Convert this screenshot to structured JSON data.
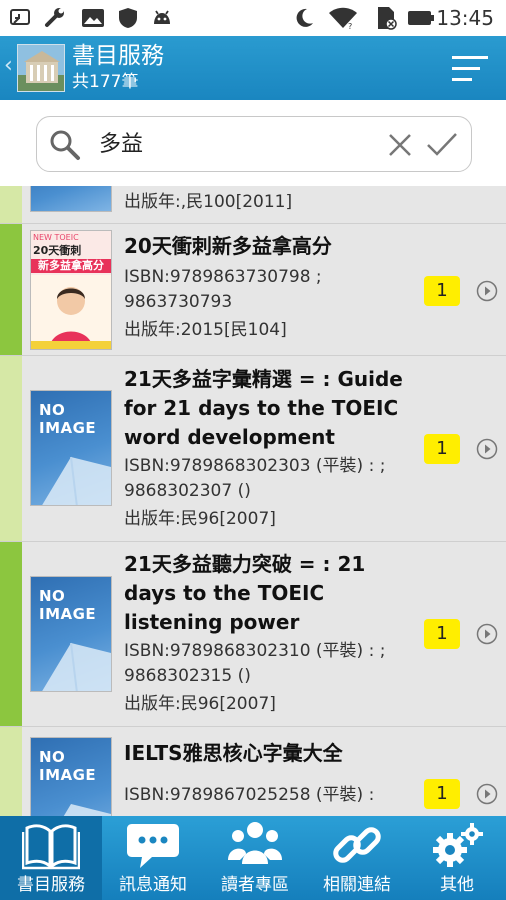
{
  "status_bar": {
    "time": "13:45",
    "icons": [
      "cast-icon",
      "wrench-icon",
      "image-icon",
      "shield-icon",
      "android-icon",
      "moon-icon",
      "wifi-icon",
      "sim-icon",
      "battery-icon"
    ]
  },
  "header": {
    "title": "書目服務",
    "subtitle": "共177筆"
  },
  "search": {
    "query": "多益"
  },
  "results": [
    {
      "cover": "partial",
      "lines": [
        "出版年:,民100[2011]"
      ]
    },
    {
      "title": "20天衝刺新多益拿高分",
      "isbn": "ISBN:9789863730798 ; 9863730793",
      "year": "出版年:2015[民104]",
      "count": "1",
      "cover_texts": [
        "NEW TOEIC",
        "20天衝刺",
        "新多益拿高分"
      ]
    },
    {
      "title": "21天多益字彙精選 = : Guide for 21 days to the TOEIC word development",
      "isbn": "ISBN:9789868302303 (平裝) : ; 9868302307 ()",
      "year": "出版年:民96[2007]",
      "count": "1",
      "noimage": "NO IMAGE"
    },
    {
      "title": "21天多益聽力突破 = : 21 days to the TOEIC listening power",
      "isbn": "ISBN:9789868302310 (平裝) : ; 9868302315 ()",
      "year": "出版年:民96[2007]",
      "count": "1",
      "noimage": "NO IMAGE"
    },
    {
      "title": "IELTS雅思核心字彙大全",
      "isbn": "ISBN:9789867025258 (平裝) :",
      "count": "1",
      "noimage": "NO IMAGE"
    }
  ],
  "tabs": [
    {
      "label": "書目服務",
      "icon": "book-icon",
      "active": true
    },
    {
      "label": "訊息通知",
      "icon": "chat-icon",
      "active": false
    },
    {
      "label": "讀者專區",
      "icon": "users-icon",
      "active": false
    },
    {
      "label": "相關連結",
      "icon": "link-icon",
      "active": false
    },
    {
      "label": "其他",
      "icon": "gears-icon",
      "active": false
    }
  ],
  "colors": {
    "header": "#1a86c0",
    "accent_green": "#8cc63f",
    "badge": "#ffee00"
  }
}
